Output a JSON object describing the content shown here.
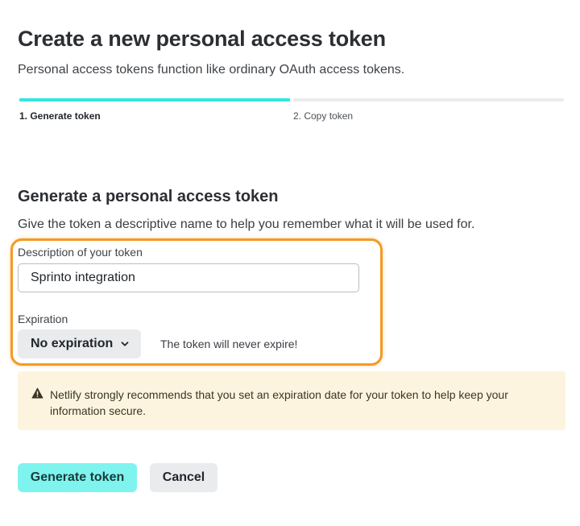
{
  "header": {
    "title": "Create a new personal access token",
    "subtitle": "Personal access tokens function like ordinary OAuth access tokens."
  },
  "steps": [
    {
      "label": "1. Generate token",
      "active": true
    },
    {
      "label": "2. Copy token",
      "active": false
    }
  ],
  "form": {
    "title": "Generate a personal access token",
    "description": "Give the token a descriptive name to help you remember what it will be used for.",
    "token_description": {
      "label": "Description of your token",
      "value": "Sprinto integration"
    },
    "expiration": {
      "label": "Expiration",
      "selected": "No expiration",
      "note": "The token will never expire!"
    },
    "warning": {
      "icon": "warning-icon",
      "text": "Netlify strongly recommends that you set an expiration date for your token to help keep your information secure."
    },
    "actions": {
      "generate_label": "Generate token",
      "cancel_label": "Cancel"
    }
  },
  "colors": {
    "accent": "#32e6e2",
    "highlight_border": "#f39a25",
    "warning_bg": "#fcf4de",
    "primary_button": "#7ff4ee"
  }
}
